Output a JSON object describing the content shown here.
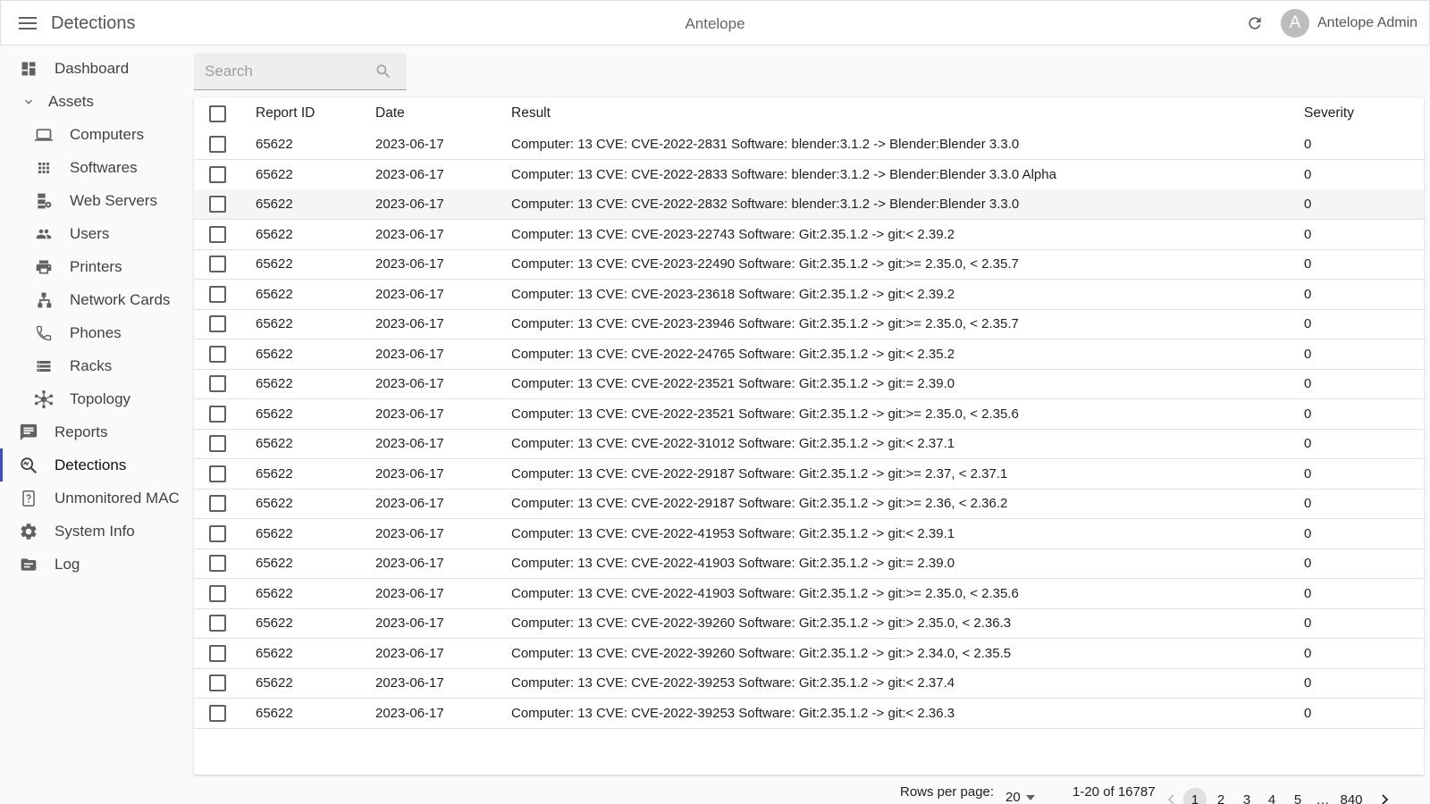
{
  "header": {
    "title": "Detections",
    "center_title": "Antelope",
    "avatar_initial": "A",
    "user_name": "Antelope Admin"
  },
  "sidebar": {
    "items": [
      {
        "label": "Dashboard",
        "icon": "dashboard-icon",
        "level": "top"
      },
      {
        "label": "Assets",
        "icon": "chevron-down-icon",
        "level": "top"
      },
      {
        "label": "Computers",
        "icon": "laptop-icon",
        "level": "sub"
      },
      {
        "label": "Softwares",
        "icon": "apps-grid-icon",
        "level": "sub"
      },
      {
        "label": "Web Servers",
        "icon": "web-server-icon",
        "level": "sub"
      },
      {
        "label": "Users",
        "icon": "people-icon",
        "level": "sub"
      },
      {
        "label": "Printers",
        "icon": "printer-icon",
        "level": "sub"
      },
      {
        "label": "Network Cards",
        "icon": "network-icon",
        "level": "sub"
      },
      {
        "label": "Phones",
        "icon": "phone-icon",
        "level": "sub"
      },
      {
        "label": "Racks",
        "icon": "rack-icon",
        "level": "sub"
      },
      {
        "label": "Topology",
        "icon": "topology-icon",
        "level": "sub"
      },
      {
        "label": "Reports",
        "icon": "report-icon",
        "level": "top"
      },
      {
        "label": "Detections",
        "icon": "detection-icon",
        "level": "top",
        "active": true
      },
      {
        "label": "Unmonitored MAC",
        "icon": "unknown-device-icon",
        "level": "top"
      },
      {
        "label": "System Info",
        "icon": "gear-icon",
        "level": "top"
      },
      {
        "label": "Log",
        "icon": "folder-icon",
        "level": "top"
      }
    ]
  },
  "search": {
    "placeholder": "Search"
  },
  "table": {
    "columns": [
      "Report ID",
      "Date",
      "Result",
      "Severity"
    ],
    "rows": [
      [
        "65622",
        "2023-06-17",
        "Computer: 13 CVE: CVE-2022-2831 Software: blender:3.1.2 -> Blender:Blender 3.3.0",
        "0"
      ],
      [
        "65622",
        "2023-06-17",
        "Computer: 13 CVE: CVE-2022-2833 Software: blender:3.1.2 -> Blender:Blender 3.3.0 Alpha",
        "0"
      ],
      [
        "65622",
        "2023-06-17",
        "Computer: 13 CVE: CVE-2022-2832 Software: blender:3.1.2 -> Blender:Blender 3.3.0",
        "0"
      ],
      [
        "65622",
        "2023-06-17",
        "Computer: 13 CVE: CVE-2023-22743 Software: Git:2.35.1.2 -> git:< 2.39.2",
        "0"
      ],
      [
        "65622",
        "2023-06-17",
        "Computer: 13 CVE: CVE-2023-22490 Software: Git:2.35.1.2 -> git:>= 2.35.0, < 2.35.7",
        "0"
      ],
      [
        "65622",
        "2023-06-17",
        "Computer: 13 CVE: CVE-2023-23618 Software: Git:2.35.1.2 -> git:< 2.39.2",
        "0"
      ],
      [
        "65622",
        "2023-06-17",
        "Computer: 13 CVE: CVE-2023-23946 Software: Git:2.35.1.2 -> git:>= 2.35.0, < 2.35.7",
        "0"
      ],
      [
        "65622",
        "2023-06-17",
        "Computer: 13 CVE: CVE-2022-24765 Software: Git:2.35.1.2 -> git:< 2.35.2",
        "0"
      ],
      [
        "65622",
        "2023-06-17",
        "Computer: 13 CVE: CVE-2022-23521 Software: Git:2.35.1.2 -> git:= 2.39.0",
        "0"
      ],
      [
        "65622",
        "2023-06-17",
        "Computer: 13 CVE: CVE-2022-23521 Software: Git:2.35.1.2 -> git:>= 2.35.0, < 2.35.6",
        "0"
      ],
      [
        "65622",
        "2023-06-17",
        "Computer: 13 CVE: CVE-2022-31012 Software: Git:2.35.1.2 -> git:< 2.37.1",
        "0"
      ],
      [
        "65622",
        "2023-06-17",
        "Computer: 13 CVE: CVE-2022-29187 Software: Git:2.35.1.2 -> git:>= 2.37, < 2.37.1",
        "0"
      ],
      [
        "65622",
        "2023-06-17",
        "Computer: 13 CVE: CVE-2022-29187 Software: Git:2.35.1.2 -> git:>= 2.36, < 2.36.2",
        "0"
      ],
      [
        "65622",
        "2023-06-17",
        "Computer: 13 CVE: CVE-2022-41953 Software: Git:2.35.1.2 -> git:< 2.39.1",
        "0"
      ],
      [
        "65622",
        "2023-06-17",
        "Computer: 13 CVE: CVE-2022-41903 Software: Git:2.35.1.2 -> git:= 2.39.0",
        "0"
      ],
      [
        "65622",
        "2023-06-17",
        "Computer: 13 CVE: CVE-2022-41903 Software: Git:2.35.1.2 -> git:>= 2.35.0, < 2.35.6",
        "0"
      ],
      [
        "65622",
        "2023-06-17",
        "Computer: 13 CVE: CVE-2022-39260 Software: Git:2.35.1.2 -> git:> 2.35.0, < 2.36.3",
        "0"
      ],
      [
        "65622",
        "2023-06-17",
        "Computer: 13 CVE: CVE-2022-39260 Software: Git:2.35.1.2 -> git:> 2.34.0, < 2.35.5",
        "0"
      ],
      [
        "65622",
        "2023-06-17",
        "Computer: 13 CVE: CVE-2022-39253 Software: Git:2.35.1.2 -> git:< 2.37.4",
        "0"
      ],
      [
        "65622",
        "2023-06-17",
        "Computer: 13 CVE: CVE-2022-39253 Software: Git:2.35.1.2 -> git:< 2.36.3",
        "0"
      ]
    ]
  },
  "pagination": {
    "rows_per_page_label": "Rows per page:",
    "rows_per_page_value": "20",
    "range_label": "1-20 of 16787",
    "pages": [
      "1",
      "2",
      "3",
      "4",
      "5",
      "…",
      "840"
    ],
    "current_page": "1"
  },
  "colors": {
    "accent": "#3f51b5",
    "icon": "#616161",
    "row_highlight": "#f5f5f5"
  }
}
